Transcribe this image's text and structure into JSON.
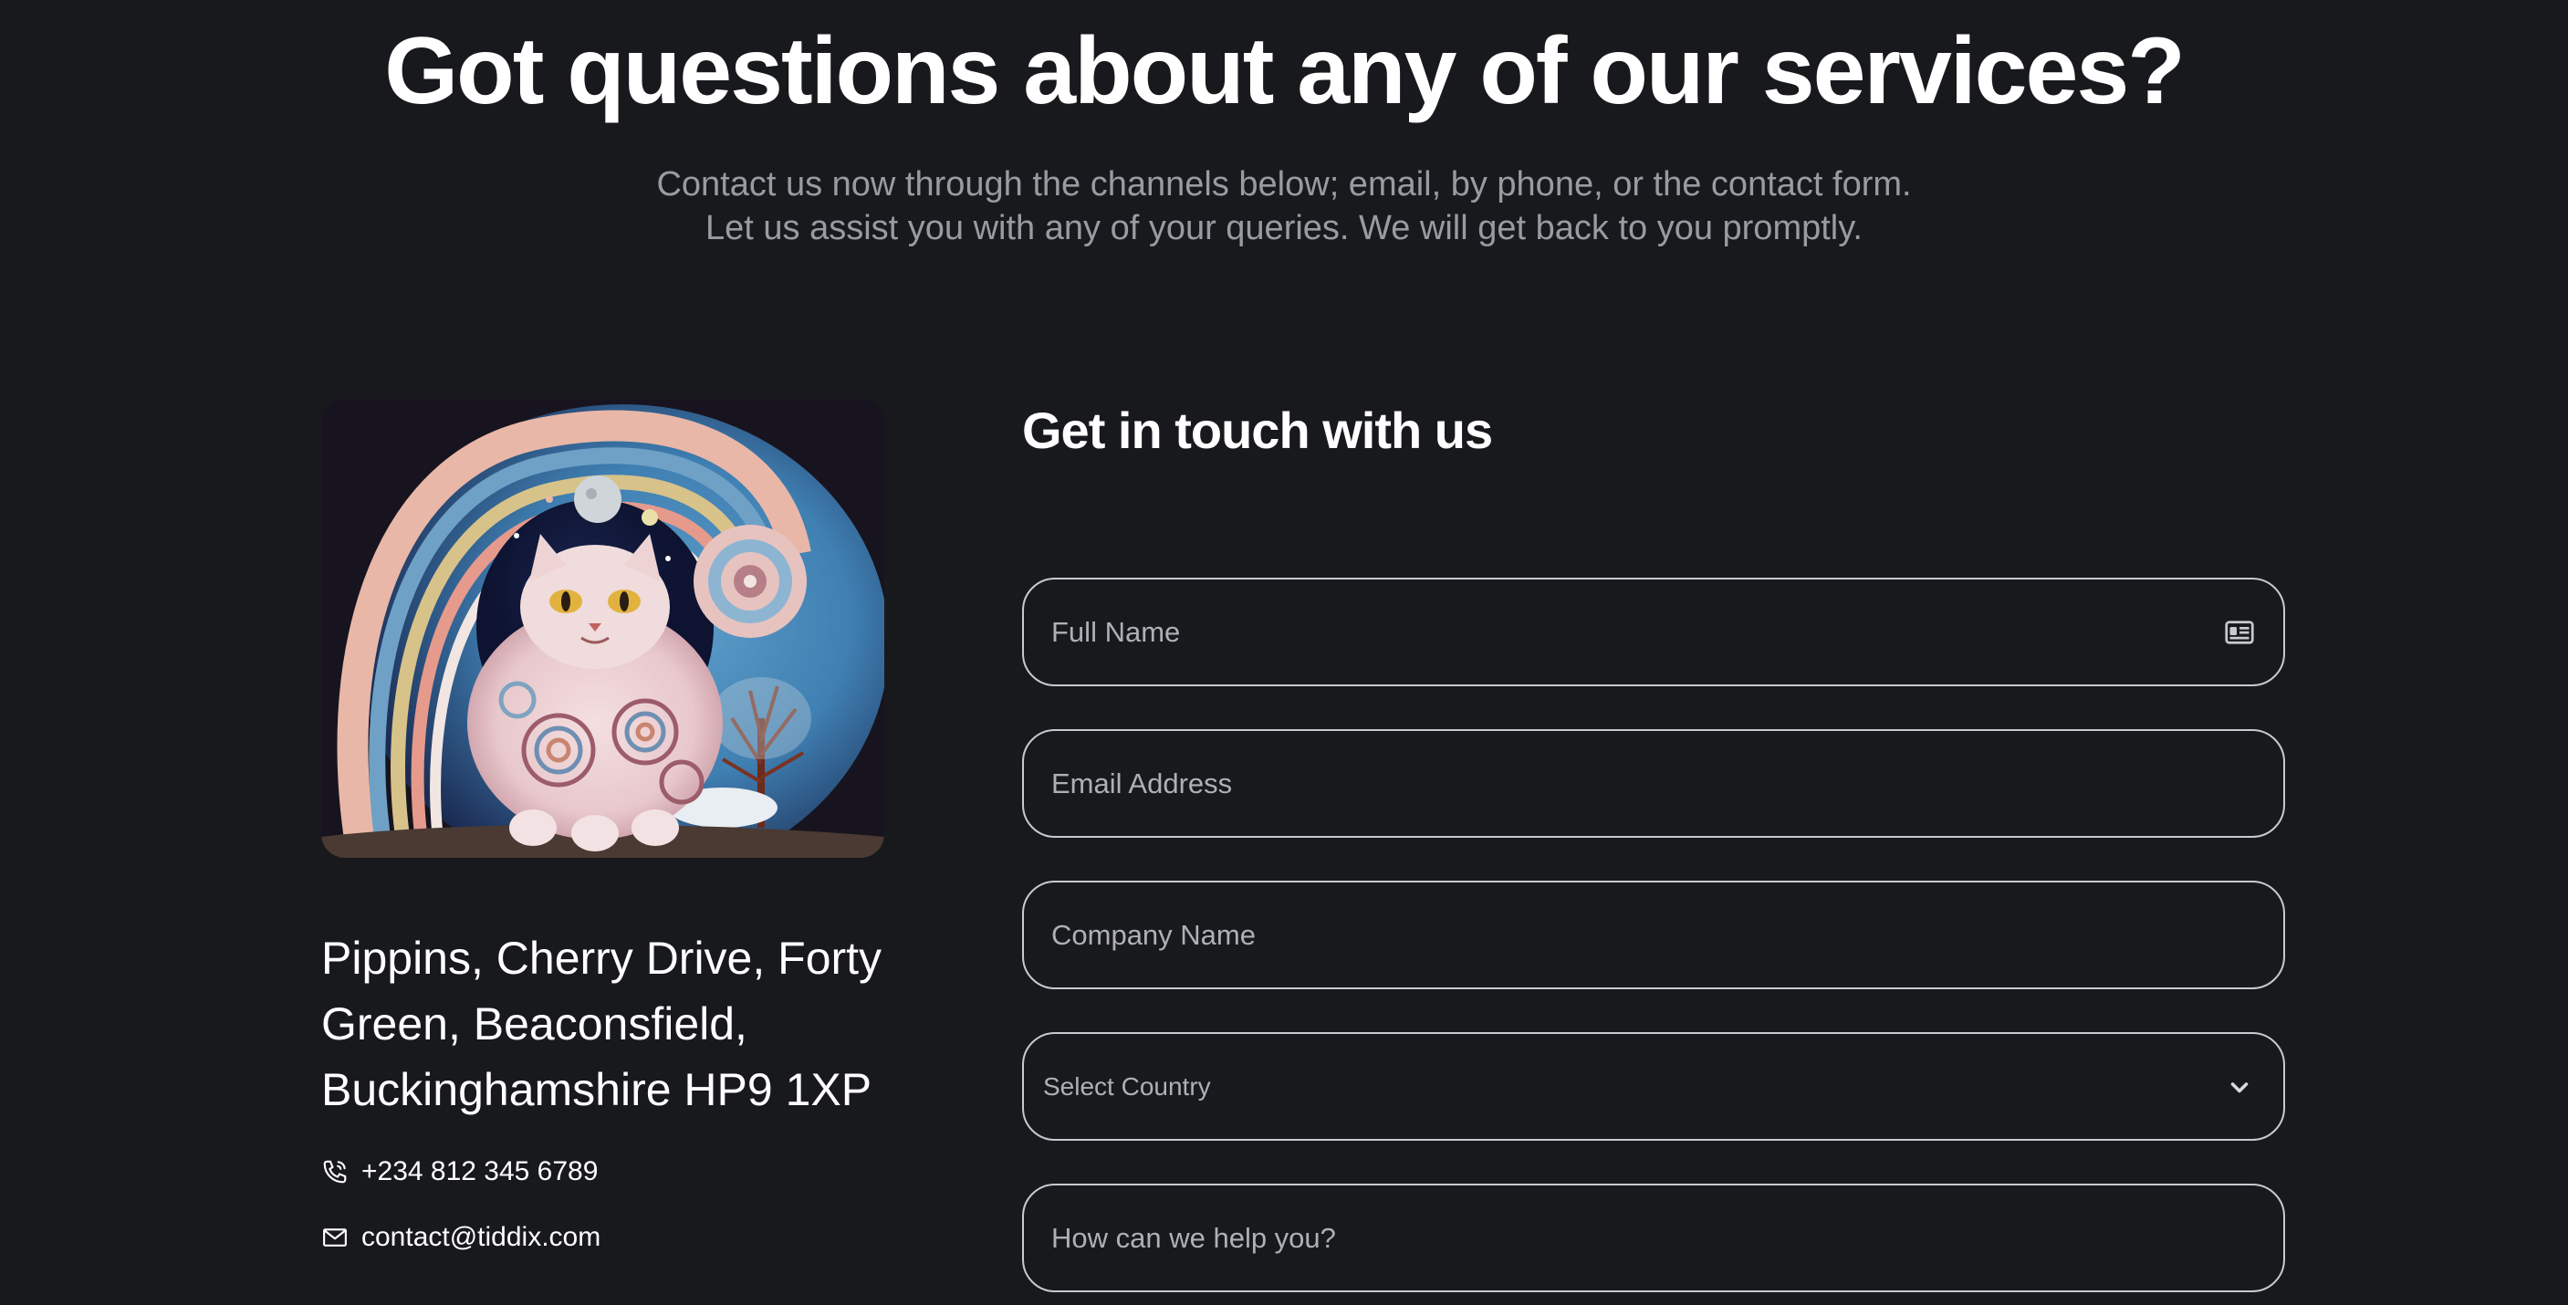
{
  "hero": {
    "title": "Got questions about any of our services?",
    "subtitle_line1": "Contact us now through the channels below; email, by phone, or the contact form.",
    "subtitle_line2": "Let us assist you with any of your queries. We will get back to you promptly."
  },
  "contact": {
    "address_line1": "Pippins, Cherry Drive, Forty",
    "address_line2": "Green, Beaconsfield,",
    "address_line3": "Buckinghamshire HP9 1XP",
    "phone": "+234 812 345 6789",
    "email": "contact@tiddix.com",
    "phone_icon": "phone-icon",
    "email_icon": "mail-icon"
  },
  "form": {
    "title": "Get in touch with us",
    "full_name_placeholder": "Full Name",
    "email_placeholder": "Email Address",
    "company_placeholder": "Company Name",
    "country_selected": "Select Country",
    "help_placeholder": "How can we help you?",
    "name_icon": "id-card-icon",
    "country_icon": "chevron-down-icon"
  },
  "colors": {
    "background": "#18191d",
    "heading": "#ffffff",
    "muted_text": "#9a9ba1",
    "field_border": "#c9cacf",
    "placeholder": "#aeb0b5"
  }
}
